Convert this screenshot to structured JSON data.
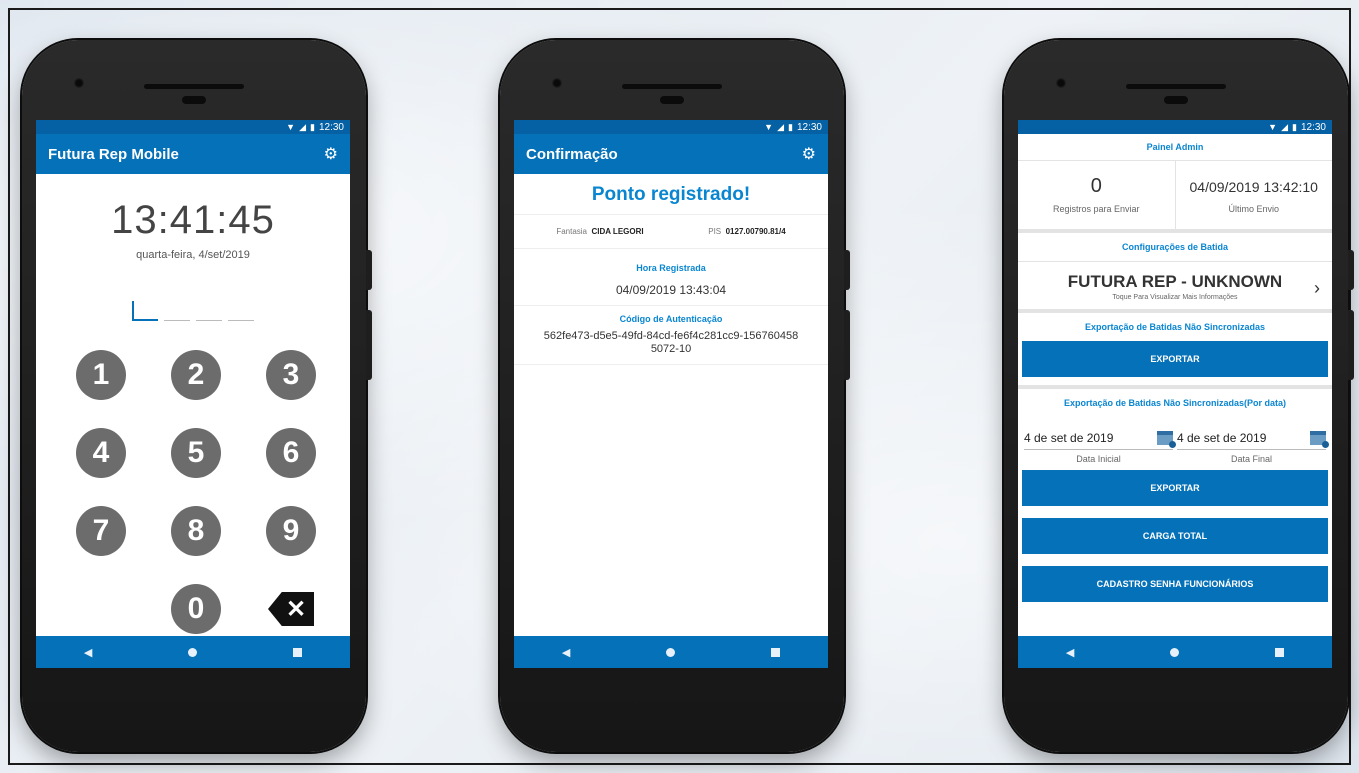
{
  "status": {
    "time": "12:30",
    "wifi_icon": "wifi-icon",
    "signal_icon": "signal-icon",
    "battery_icon": "battery-icon"
  },
  "phone1": {
    "app_title": "Futura Rep Mobile",
    "clock": "13:41:45",
    "date": "quarta-feira, 4/set/2019",
    "keys": [
      "1",
      "2",
      "3",
      "4",
      "5",
      "6",
      "7",
      "8",
      "9",
      "0"
    ],
    "backspace_glyph": "✕"
  },
  "phone2": {
    "app_title": "Confirmação",
    "headline": "Ponto registrado!",
    "fantasia_label": "Fantasia",
    "fantasia_value": "CIDA LEGORI",
    "pis_label": "PIS",
    "pis_value": "0127.00790.81/4",
    "hora_label": "Hora Registrada",
    "hora_value": "04/09/2019 13:43:04",
    "codigo_label": "Código de Autenticação",
    "codigo_value_line1": "562fe473-d5e5-49fd-84cd-fe6f4c281cc9-156760458",
    "codigo_value_line2": "5072-10"
  },
  "phone3": {
    "panel_title": "Painel Admin",
    "registros_count": "0",
    "registros_label": "Registros para Enviar",
    "ultimo_envio_value": "04/09/2019 13:42:10",
    "ultimo_envio_label": "Último Envio",
    "config_title": "Configurações de Batida",
    "rep_name": "FUTURA REP - UNKNOWN",
    "rep_hint": "Toque Para Visualizar Mais Informações",
    "export_title": "Exportação de Batidas Não Sincronizadas",
    "export_btn": "EXPORTAR",
    "export_date_title": "Exportação de Batidas Não Sincronizadas(Por data)",
    "date_start": "4 de set de 2019",
    "date_end": "4 de set de 2019",
    "date_start_label": "Data Inicial",
    "date_end_label": "Data Final",
    "export_btn2": "EXPORTAR",
    "carga_btn": "CARGA TOTAL",
    "cadastro_btn": "CADASTRO SENHA FUNCIONÁRIOS"
  },
  "nav": {
    "back": "◀",
    "home_icon": "home-icon",
    "recent_icon": "recent-apps-icon"
  },
  "colors": {
    "primary": "#0571b8",
    "accent": "#0a86d1",
    "key": "#6c6c6c"
  }
}
